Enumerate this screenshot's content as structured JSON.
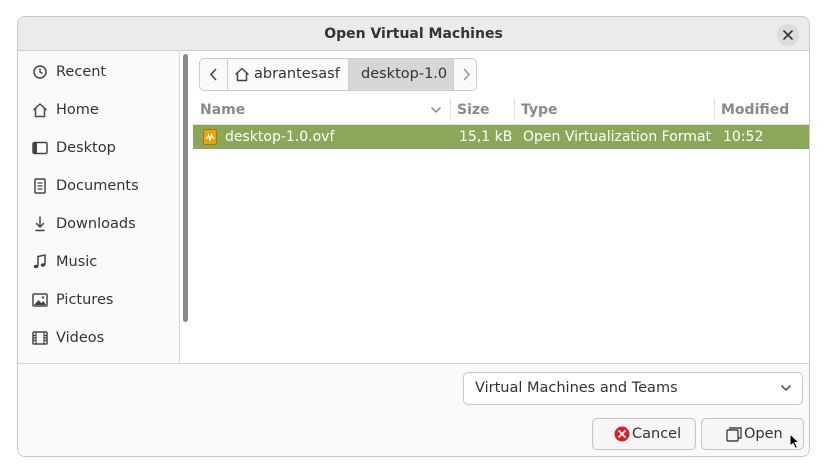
{
  "window": {
    "title": "Open Virtual Machines"
  },
  "sidebar": {
    "items": [
      {
        "label": "Recent",
        "icon": "clock-icon"
      },
      {
        "label": "Home",
        "icon": "home-icon"
      },
      {
        "label": "Desktop",
        "icon": "desktop-icon"
      },
      {
        "label": "Documents",
        "icon": "document-icon"
      },
      {
        "label": "Downloads",
        "icon": "download-icon"
      },
      {
        "label": "Music",
        "icon": "music-icon"
      },
      {
        "label": "Pictures",
        "icon": "picture-icon"
      },
      {
        "label": "Videos",
        "icon": "video-icon"
      }
    ]
  },
  "pathbar": {
    "home_label": "abrantesasf",
    "current_label": "desktop-1.0"
  },
  "columns": {
    "name": "Name",
    "size": "Size",
    "type": "Type",
    "modified": "Modified"
  },
  "files": [
    {
      "name": "desktop-1.0.ovf",
      "size": "15,1 kB",
      "type": "Open Virtualization Format",
      "modified": "10:52",
      "selected": true
    }
  ],
  "filter": {
    "selected": "Virtual Machines and Teams"
  },
  "buttons": {
    "cancel": "Cancel",
    "open": "Open"
  },
  "colors": {
    "selection": "#8ba85a",
    "cancel_icon": "#e01b24",
    "file_icon": "#e5a50a"
  }
}
